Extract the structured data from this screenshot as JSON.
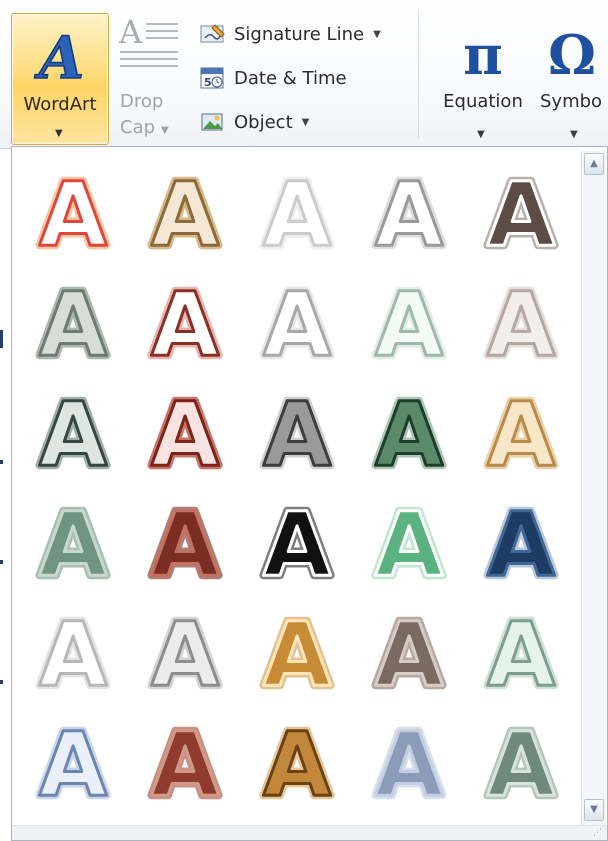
{
  "ribbon": {
    "wordart": {
      "label": "WordArt",
      "icon": "wordart-a-icon"
    },
    "dropcap": {
      "label_line1": "Drop",
      "label_line2": "Cap",
      "icon": "drop-cap-icon"
    },
    "signature_line": {
      "label": "Signature Line",
      "icon": "signature-pen-icon"
    },
    "date_time": {
      "label": "Date & Time",
      "icon": "calendar-icon"
    },
    "object": {
      "label": "Object",
      "icon": "object-icon"
    },
    "equation": {
      "label": "Equation",
      "symbol": "π",
      "icon": "pi-icon"
    },
    "symbol": {
      "label": "Symbo",
      "symbol": "Ω",
      "icon": "omega-icon"
    }
  },
  "gallery": {
    "glyph": "A",
    "styles": [
      {
        "fill": "#ffffff",
        "stroke": "#e0463a",
        "glow": "#f6c6a2"
      },
      {
        "fill": "#f4e8d4",
        "stroke": "#8c6a3a",
        "glow": "#d8b98a"
      },
      {
        "fill": "#ffffff",
        "stroke": "#cccccc",
        "glow": "#eeeeee"
      },
      {
        "fill": "#ffffff",
        "stroke": "#9a9a9a",
        "glow": "#dddddd"
      },
      {
        "fill": "#5d4b45",
        "stroke": "#ffffff",
        "glow": "#b9b0ab"
      },
      {
        "fill": "#d8ddd8",
        "stroke": "#6d7b73",
        "glow": "#aab8b0"
      },
      {
        "fill": "#ffffff",
        "stroke": "#8a2f26",
        "glow": "#e5b5ae"
      },
      {
        "fill": "#ffffff",
        "stroke": "#a8a8a8",
        "glow": "#e8e8e8"
      },
      {
        "fill": "#f4faf6",
        "stroke": "#9fb8ac",
        "glow": "#e2ece6"
      },
      {
        "fill": "#f2eeec",
        "stroke": "#b5a7a2",
        "glow": "#e6dfdc"
      },
      {
        "fill": "#dfe6e2",
        "stroke": "#344740",
        "glow": "#a1b0aa"
      },
      {
        "fill": "#f7e4e0",
        "stroke": "#7c2219",
        "glow": "#c4766b"
      },
      {
        "fill": "#9a9a9a",
        "stroke": "#3d3d3d",
        "glow": "#cfcfcf"
      },
      {
        "fill": "#5a8a6a",
        "stroke": "#1f3d2b",
        "glow": "#a9c7b4"
      },
      {
        "fill": "#f8e6c9",
        "stroke": "#b88a4c",
        "glow": "#ead1a8"
      },
      {
        "fill": "#6f9480",
        "stroke": "#c8d8cf",
        "glow": "#a8bfb2"
      },
      {
        "fill": "#7a2d22",
        "stroke": "#c2705f",
        "glow": "#b08076"
      },
      {
        "fill": "#111111",
        "stroke": "#ffffff",
        "glow": "#7e7e7e"
      },
      {
        "fill": "#5ab37e",
        "stroke": "#ffffff",
        "glow": "#bfe6ce"
      },
      {
        "fill": "#1e3b64",
        "stroke": "#3f6897",
        "glow": "#b9c8db"
      },
      {
        "fill": "#ffffff",
        "stroke": "#b7b7b7",
        "glow": "#e4e4e4"
      },
      {
        "fill": "#ececec",
        "stroke": "#8d8d8d",
        "glow": "#d4d4d4"
      },
      {
        "fill": "#c88a35",
        "stroke": "#ffe7b8",
        "glow": "#e3c190"
      },
      {
        "fill": "#7a6a62",
        "stroke": "#d7ccc6",
        "glow": "#b7a9a1"
      },
      {
        "fill": "#e6f2ec",
        "stroke": "#7e9e8f",
        "glow": "#cfe0d7"
      },
      {
        "fill": "#e9f0fa",
        "stroke": "#6d86ad",
        "glow": "#c9d6ea"
      },
      {
        "fill": "#8f3b2e",
        "stroke": "#d29989",
        "glow": "#c99084"
      },
      {
        "fill": "#c2873a",
        "stroke": "#6a4216",
        "glow": "#e6c79a"
      },
      {
        "fill": "#8a9cb8",
        "stroke": "#c3cfe0",
        "glow": "#d7e0ec"
      },
      {
        "fill": "#6f8a7c",
        "stroke": "#d7e4dd",
        "glow": "#b5c6bd"
      }
    ]
  },
  "scrollbar": {
    "up_icon": "scroll-up-arrow-icon",
    "down_icon": "scroll-down-arrow-icon"
  },
  "statusbar": {
    "grip_icon": "resize-grip-icon"
  }
}
